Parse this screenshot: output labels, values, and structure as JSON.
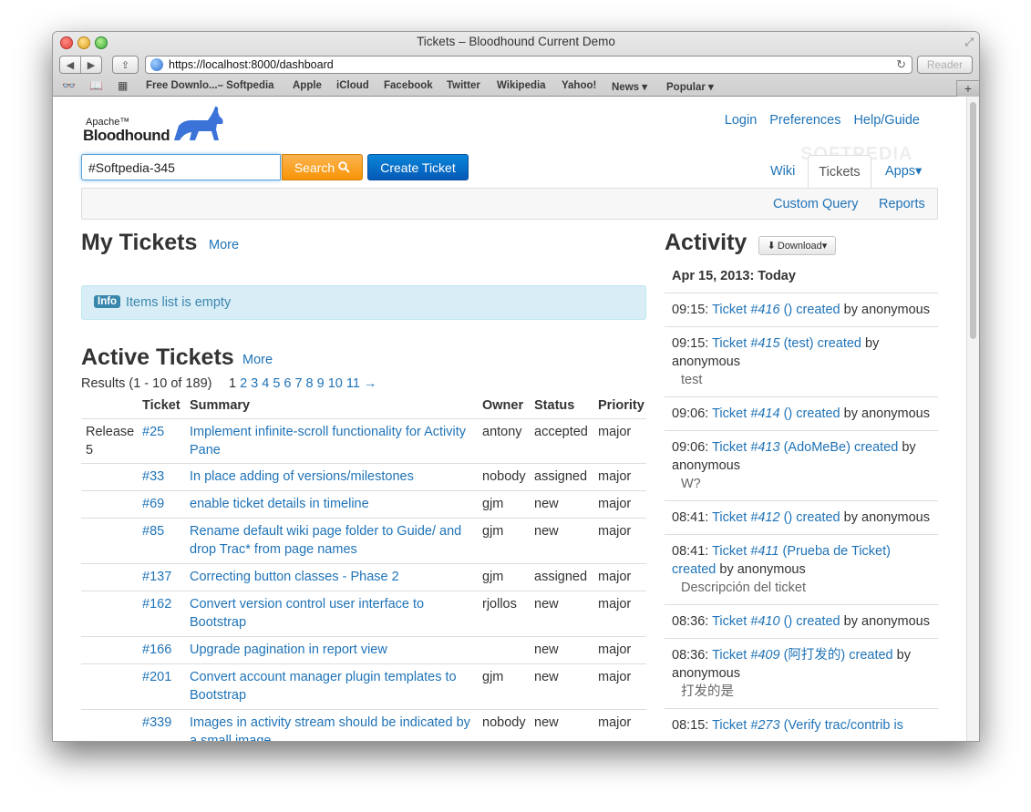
{
  "window": {
    "title": "Tickets – Bloodhound Current Demo"
  },
  "toolbar": {
    "url": "https://localhost:8000/dashboard",
    "reader_label": "Reader",
    "back": "◀",
    "forward": "▶",
    "share": "⇪",
    "reload": "↻"
  },
  "bookmarks": [
    "Free Downlo...– Softpedia",
    "Apple",
    "iCloud",
    "Facebook",
    "Twitter",
    "Wikipedia",
    "Yahoo!",
    "News ▾",
    "Popular ▾"
  ],
  "site": {
    "logo_small": "Apache™",
    "logo_big": "Bloodhound",
    "top_links": [
      "Login",
      "Preferences",
      "Help/Guide"
    ],
    "search_value": "#Softpedia-345",
    "search_label": "Search",
    "create_label": "Create Ticket",
    "nav_tabs": [
      "Wiki",
      "Tickets",
      "Apps▾"
    ],
    "subnav": [
      "Custom Query",
      "Reports"
    ],
    "watermark": "SOFTPEDIA"
  },
  "my_tickets": {
    "title": "My Tickets",
    "more": "More",
    "badge": "Info",
    "empty_text": "Items list is empty"
  },
  "active": {
    "title": "Active Tickets",
    "more": "More",
    "results": "Results (1 - 10 of 189)",
    "pages": [
      "1",
      "2",
      "3",
      "4",
      "5",
      "6",
      "7",
      "8",
      "9",
      "10",
      "11",
      "→"
    ],
    "headers": [
      "Ticket",
      "Summary",
      "Owner",
      "Status",
      "Priority"
    ],
    "rows": [
      {
        "group": "Release 5",
        "ticket": "#25",
        "summary": "Implement infinite-scroll functionality for Activity Pane",
        "owner": "antony",
        "status": "accepted",
        "priority": "major"
      },
      {
        "group": "",
        "ticket": "#33",
        "summary": "In place adding of versions/milestones",
        "owner": "nobody",
        "status": "assigned",
        "priority": "major"
      },
      {
        "group": "",
        "ticket": "#69",
        "summary": "enable ticket details in timeline",
        "owner": "gjm",
        "status": "new",
        "priority": "major"
      },
      {
        "group": "",
        "ticket": "#85",
        "summary": "Rename default wiki page folder to Guide/ and drop Trac* from page names",
        "owner": "gjm",
        "status": "new",
        "priority": "major"
      },
      {
        "group": "",
        "ticket": "#137",
        "summary": "Correcting button classes - Phase 2",
        "owner": "gjm",
        "status": "assigned",
        "priority": "major"
      },
      {
        "group": "",
        "ticket": "#162",
        "summary": "Convert version control user interface to Bootstrap",
        "owner": "rjollos",
        "status": "new",
        "priority": "major"
      },
      {
        "group": "",
        "ticket": "#166",
        "summary": "Upgrade pagination in report view",
        "owner": "",
        "status": "new",
        "priority": "major"
      },
      {
        "group": "",
        "ticket": "#201",
        "summary": "Convert account manager plugin templates to Bootstrap",
        "owner": "gjm",
        "status": "new",
        "priority": "major"
      },
      {
        "group": "",
        "ticket": "#339",
        "summary": "Images in activity stream should be indicated by a small image",
        "owner": "nobody",
        "status": "new",
        "priority": "major"
      }
    ]
  },
  "activity": {
    "title": "Activity",
    "download_label": "Download▾",
    "day": "Apr 15, 2013: Today",
    "items": [
      {
        "time": "09:15:",
        "ticket": "#416",
        "rest": " () created",
        "by": " by anonymous",
        "detail": ""
      },
      {
        "time": "09:15:",
        "ticket": "#415",
        "rest": " (test) created",
        "by": " by anonymous",
        "detail": "test"
      },
      {
        "time": "09:06:",
        "ticket": "#414",
        "rest": " () created",
        "by": " by anonymous",
        "detail": ""
      },
      {
        "time": "09:06:",
        "ticket": "#413",
        "rest": " (AdoMeBe) created",
        "by": " by anonymous",
        "detail": "W?"
      },
      {
        "time": "08:41:",
        "ticket": "#412",
        "rest": " () created",
        "by": " by anonymous",
        "detail": ""
      },
      {
        "time": "08:41:",
        "ticket": "#411",
        "rest": " (Prueba de Ticket) created",
        "by": " by anonymous",
        "detail": "Descripción del ticket"
      },
      {
        "time": "08:36:",
        "ticket": "#410",
        "rest": " () created",
        "by": " by anonymous",
        "detail": ""
      },
      {
        "time": "08:36:",
        "ticket": "#409",
        "rest": " (阿打发的) created",
        "by": " by anonymous",
        "detail": "打发的是"
      },
      {
        "time": "08:15:",
        "ticket": "#273",
        "rest": " (Verify trac/contrib is",
        "by": "",
        "detail": ""
      }
    ]
  }
}
